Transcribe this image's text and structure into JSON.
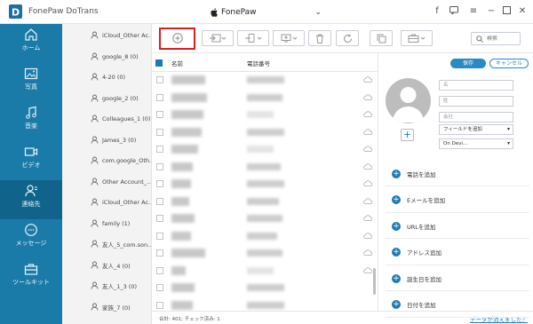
{
  "app": {
    "name": "FonePaw DoTrans",
    "device": "FonePaw"
  },
  "sidebar": {
    "items": [
      {
        "label": "ホーム",
        "icon": "home-icon"
      },
      {
        "label": "写真",
        "icon": "photo-icon"
      },
      {
        "label": "音楽",
        "icon": "music-icon"
      },
      {
        "label": "ビデオ",
        "icon": "video-icon"
      },
      {
        "label": "連絡先",
        "icon": "contacts-icon",
        "active": true
      },
      {
        "label": "メッセージ",
        "icon": "message-icon"
      },
      {
        "label": "ツールキット",
        "icon": "toolkit-icon"
      }
    ]
  },
  "groups": [
    "iCloud_Other Ac...",
    "google_8 (0)",
    "4-20 (0)",
    "google_2 (0)",
    "Colleagues_1 (0)",
    "James_3 (0)",
    "com.google_Oth...",
    "Other Account_...",
    "iCloud_Other Ac...",
    "family (1)",
    "友人_5_com.son...",
    "友人_4 (0)",
    "友人_1_3 (0)",
    "家族_7 (0)"
  ],
  "toolbar": {
    "search_placeholder": "検索"
  },
  "table": {
    "headers": {
      "name": "名前",
      "phone": "電話番号"
    },
    "rows": [
      {
        "name_w": 38,
        "phone_w": 42
      },
      {
        "name_w": 40,
        "phone_w": 40
      },
      {
        "name_w": 36,
        "phone_w": 0
      },
      {
        "name_w": 34,
        "phone_w": 42
      },
      {
        "name_w": 30,
        "phone_w": 0
      },
      {
        "name_w": 24,
        "phone_w": 38
      },
      {
        "name_w": 22,
        "phone_w": 42
      },
      {
        "name_w": 20,
        "phone_w": 36
      },
      {
        "name_w": 26,
        "phone_w": 40
      },
      {
        "name_w": 22,
        "phone_w": 34
      },
      {
        "name_w": 38,
        "phone_w": 40
      },
      {
        "name_w": 16,
        "phone_w": 0
      },
      {
        "name_w": 26,
        "phone_w": 42
      },
      {
        "name_w": 24,
        "phone_w": 42
      }
    ]
  },
  "footer": {
    "count": "合計: 401; チェック済み: 1",
    "missing_link": "データが消えました？"
  },
  "detail": {
    "save": "保存",
    "cancel": "キャンセル",
    "fields": {
      "first": "名",
      "last": "姓",
      "company": "会社"
    },
    "add_field_select": "フィールドを追加",
    "device_select": "On Devi...",
    "add_items": [
      "電話を追加",
      "Eメールを追加",
      "URLを追加",
      "アドレス追加",
      "誕生日を追加",
      "日付を追加"
    ]
  },
  "colors": {
    "sidebar": "#1b7ba8",
    "accent": "#1d7ab3",
    "highlight": "#d71f26"
  }
}
